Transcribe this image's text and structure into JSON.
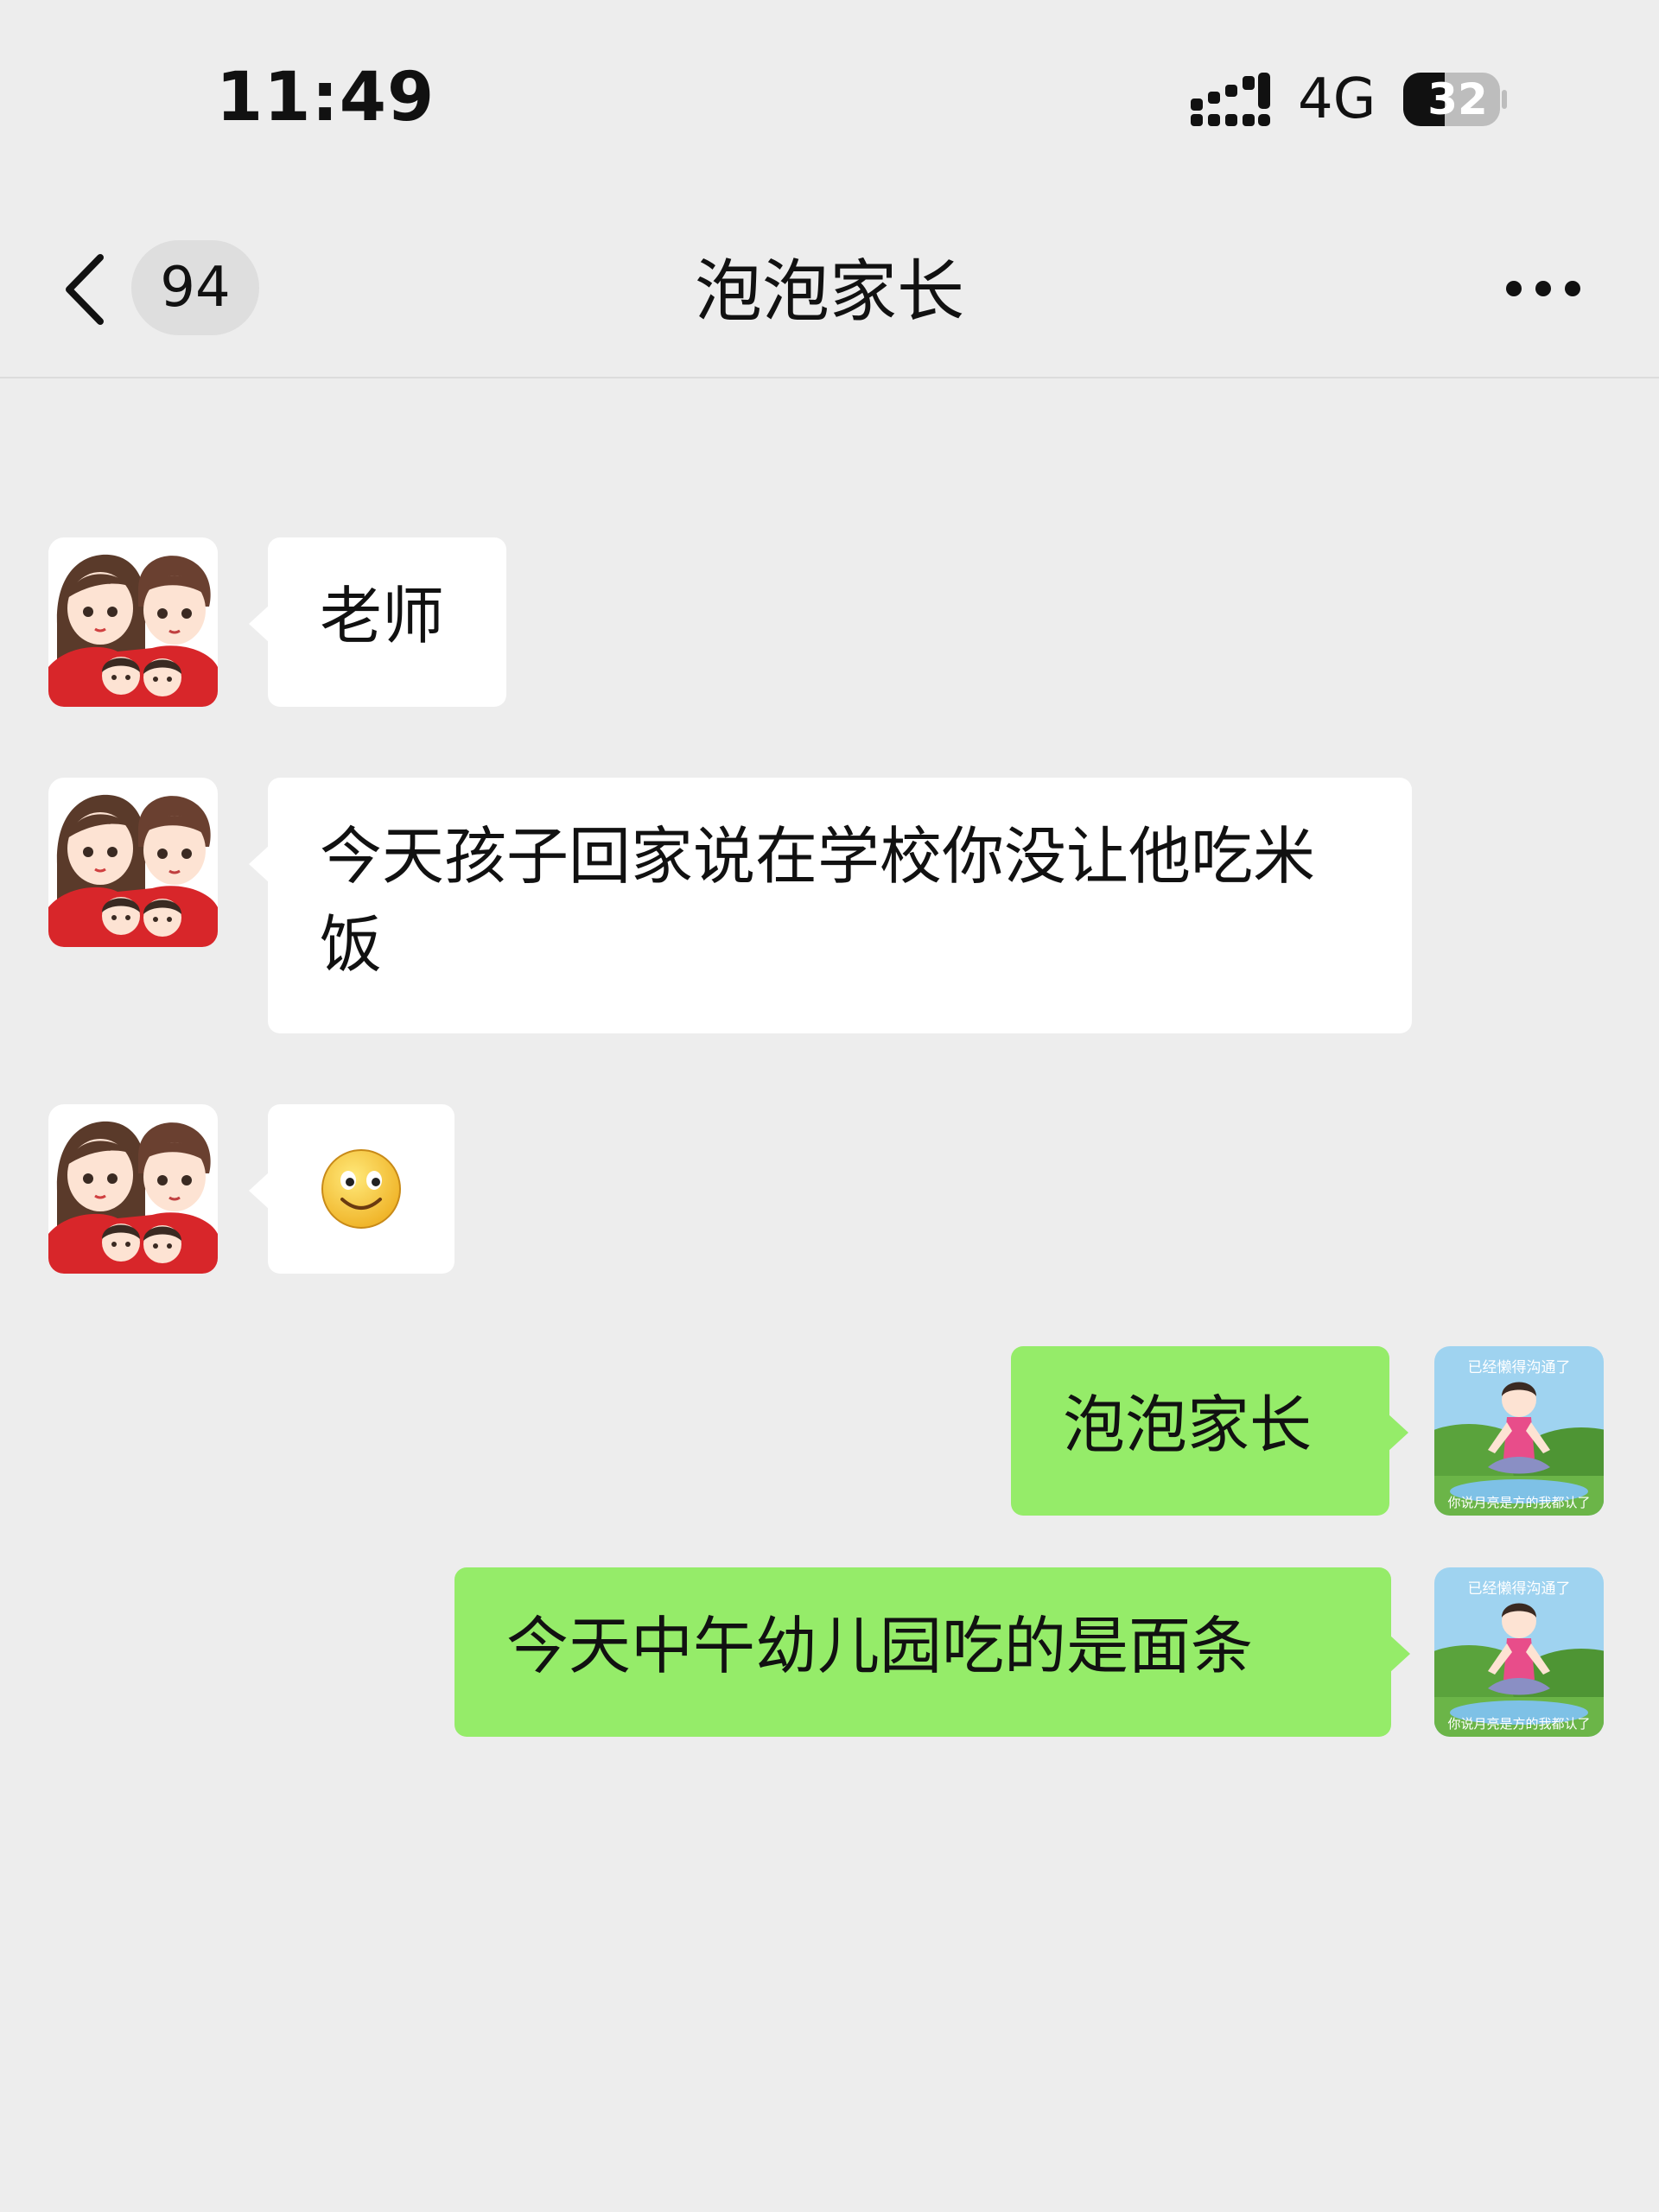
{
  "status_bar": {
    "time": "11:49",
    "network": "4G",
    "battery": "32"
  },
  "nav": {
    "unread_count": "94",
    "title": "泡泡家长"
  },
  "messages": [
    {
      "side": "left",
      "text": "老师"
    },
    {
      "side": "left",
      "text": "今天孩子回家说在学校你没让他吃米饭"
    },
    {
      "side": "left",
      "text": "",
      "emoji": "smile-emoji"
    },
    {
      "side": "right",
      "text": "泡泡家长"
    },
    {
      "side": "right",
      "text": "今天中午幼儿园吃的是面条"
    }
  ],
  "self_avatar": {
    "caption_top": "已经懒得沟通了",
    "caption_bottom": "你说月亮是方的我都认了"
  },
  "colors": {
    "background": "#ededed",
    "sent_bubble": "#95ec69",
    "received_bubble": "#ffffff"
  }
}
